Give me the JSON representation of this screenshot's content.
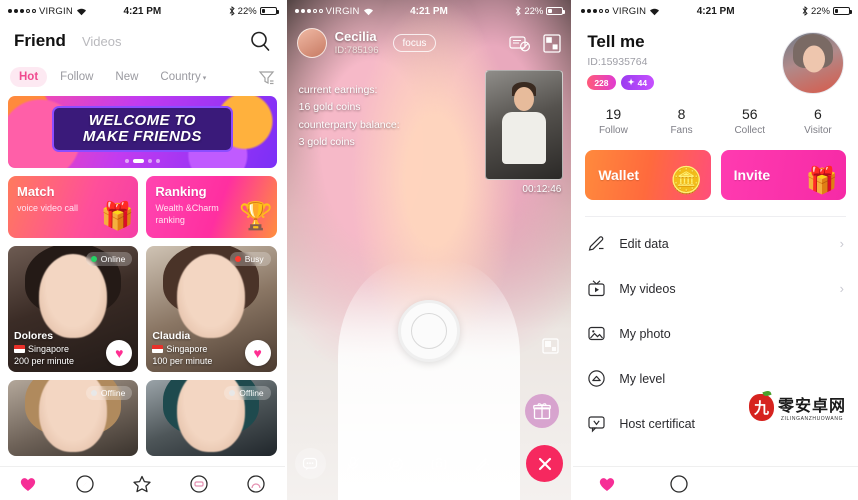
{
  "status_bar": {
    "carrier": "VIRGIN",
    "time": "4:21 PM",
    "battery": "22%"
  },
  "panel_friends": {
    "title": "Friend",
    "subtitle": "Videos",
    "tabs": [
      {
        "label": "Hot",
        "active": true
      },
      {
        "label": "Follow",
        "active": false
      },
      {
        "label": "New",
        "active": false
      },
      {
        "label": "Country",
        "active": false,
        "caret": "▾"
      }
    ],
    "search_icon": "search-icon",
    "filter_icon": "filter-icon",
    "banner": {
      "line1": "WELCOME TO",
      "line2": "MAKE FRIENDS"
    },
    "promo_cards": [
      {
        "title": "Match",
        "desc": "voice video call",
        "icon": "🎁"
      },
      {
        "title": "Ranking",
        "desc": "Wealth &Charm ranking",
        "icon": "🏆"
      }
    ],
    "user_cards": [
      {
        "name": "Dolores",
        "country": "Singapore",
        "price": "200 per minute",
        "status": "Online"
      },
      {
        "name": "Claudia",
        "country": "Singapore",
        "price": "100 per minute",
        "status": "Busy"
      },
      {
        "name": "",
        "country": "",
        "price": "",
        "status": "Offline"
      },
      {
        "name": "",
        "country": "",
        "price": "",
        "status": "Offline"
      }
    ],
    "tabbar": [
      "heart-icon",
      "compass-icon",
      "star-icon",
      "message-icon",
      "person-icon"
    ]
  },
  "panel_call": {
    "caller_name": "Cecilia",
    "caller_id": "ID:785196",
    "focus_label": "focus",
    "earnings_label": "current earnings:",
    "earnings_value": "16 gold coins",
    "balance_label": "counterparty balance:",
    "balance_value": "3 gold coins",
    "timer": "00:12:46",
    "head_icons": [
      "chat-disabled-icon",
      "minimize-icon"
    ],
    "snapshot_icon": "snapshot-icon",
    "gift_icon": "🎁",
    "controls": [
      "chat-icon",
      "mic-off-icon",
      "camera-off-icon",
      "snapshot-camera-icon",
      "beauty-effects-icon",
      "end-call-icon"
    ]
  },
  "panel_profile": {
    "name": "Tell me",
    "id": "ID:15935764",
    "badges": [
      {
        "text": "228",
        "type": "level"
      },
      {
        "text": "44",
        "type": "star",
        "icon": "✦"
      }
    ],
    "stats": [
      {
        "value": "19",
        "label": "Follow"
      },
      {
        "value": "8",
        "label": "Fans"
      },
      {
        "value": "56",
        "label": "Collect"
      },
      {
        "value": "6",
        "label": "Visitor"
      }
    ],
    "action_buttons": [
      {
        "label": "Wallet",
        "icon": "🪙"
      },
      {
        "label": "Invite",
        "icon": "🎁"
      }
    ],
    "menu": [
      {
        "label": "Edit data",
        "icon": "pencil-icon",
        "chevron": "›"
      },
      {
        "label": "My videos",
        "icon": "video-icon",
        "chevron": "›"
      },
      {
        "label": "My photo",
        "icon": "photo-icon",
        "chevron": ""
      },
      {
        "label": "My level",
        "icon": "level-icon",
        "chevron": ""
      },
      {
        "label": "Host certificat",
        "icon": "certificate-icon",
        "chevron": ""
      }
    ],
    "watermark": {
      "mark": "九",
      "cn": "零安卓网",
      "en": "ZILINGANZHUOWANG"
    },
    "tabbar": [
      "heart-icon",
      "compass-icon"
    ]
  }
}
